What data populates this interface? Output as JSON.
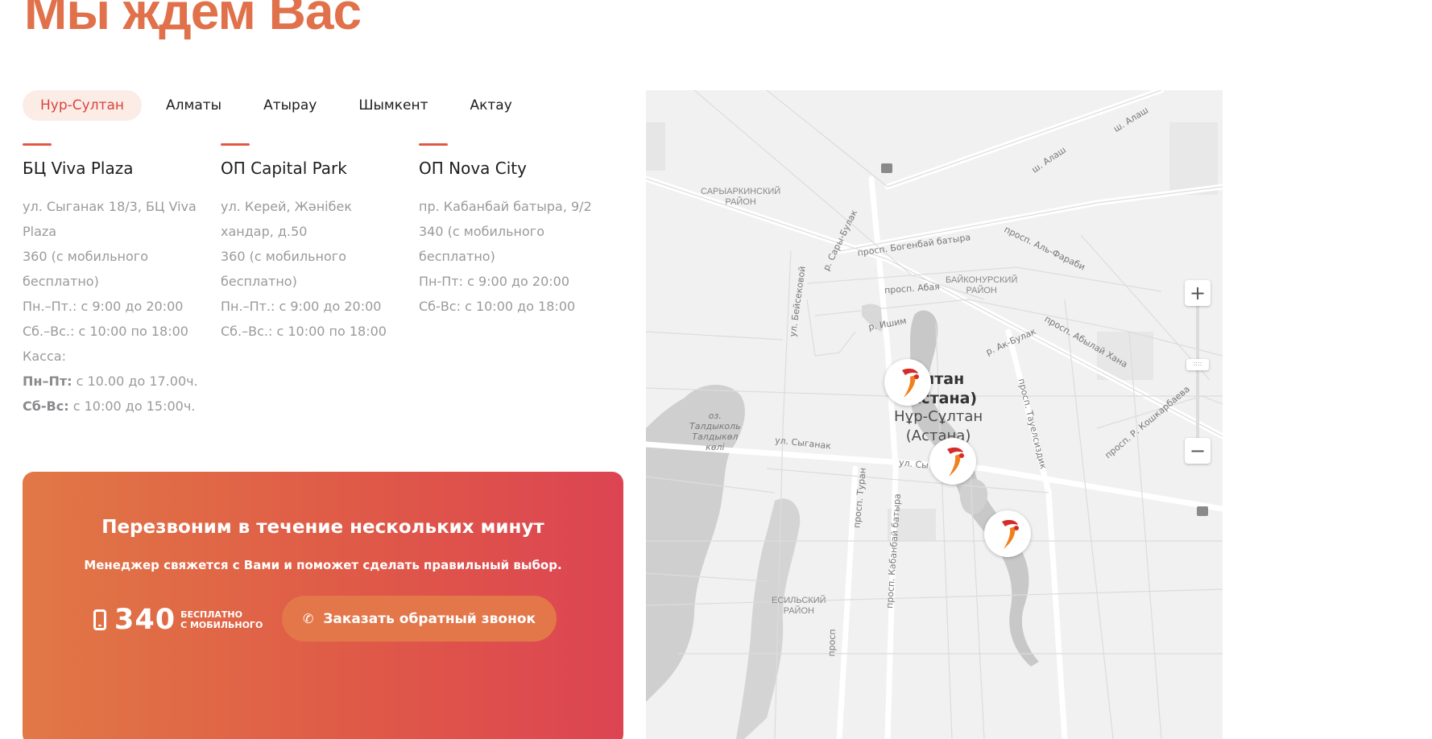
{
  "page": {
    "title": "Мы ждем Вас"
  },
  "cities": [
    "Нур-Султан",
    "Алматы",
    "Атырау",
    "Шымкент",
    "Актау"
  ],
  "active_city": "Нур-Султан",
  "offices": [
    {
      "name": "БЦ Viva Plaza",
      "lines": [
        "ул. Сыганак 18/3, БЦ Viva",
        "Plaza",
        "360 (с мобильного",
        "бесплатно)",
        "Пн.–Пт.: с 9:00 до 20:00",
        "Сб.–Вс.: с 10:00 по 18:00",
        "Касса:"
      ],
      "cash": [
        {
          "days": "Пн–Пт:",
          "hours": " с 10.00 до 17.00ч."
        },
        {
          "days": "Сб-Вс:",
          "hours": " с 10:00 до 15:00ч."
        }
      ]
    },
    {
      "name": "ОП Capital Park",
      "lines": [
        "ул. Керей, Жәнібек",
        "хандар, д.50",
        "360 (с мобильного",
        "бесплатно)",
        "Пн.–Пт.: с 9:00 до 20:00",
        "Сб.–Вс.: с 10:00 по 18:00"
      ],
      "cash": []
    },
    {
      "name": "ОП Nova City",
      "lines": [
        "пр. Кабанбай батыра, 9/2",
        "340 (с мобильного",
        "бесплатно)",
        "Пн-Пт: с 9:00 до 20:00",
        "Сб-Вс: с 10:00 до 18:00"
      ],
      "cash": []
    }
  ],
  "callback": {
    "title": "Перезвоним в течение нескольких минут",
    "subtitle": "Менеджер свяжется с Вами и поможет сделать правильный выбор.",
    "phone": "340",
    "phone_note_1": "БЕСПЛАТНО",
    "phone_note_2": "С МОБИЛЬНОГО",
    "button_label": "Заказать обратный звонок",
    "phone_icon": "mobile-phone-icon",
    "button_icon": "handset-icon"
  },
  "map": {
    "districts": {
      "saryarka": [
        "САРЫАРКИНСКИЙ",
        "РАЙОН"
      ],
      "baikonur": [
        "БАЙКОНУРСКИЙ",
        "РАЙОН"
      ],
      "esil": [
        "ЕСИЛЬСКИЙ",
        "РАЙОН"
      ]
    },
    "streets": {
      "alash1": "ш. Алаш",
      "alash2": "ш. Алаш",
      "farabi": "просп. Аль-Фараби",
      "bogenbai": "просп. Богенбай батыра",
      "abai": "просп. Абая",
      "sary_bulak": "р. Сары-Булак",
      "beibekova": "ул. Бейсековой",
      "ishim": "р. Ишим",
      "ak_bulak": "р. Ак-Булак",
      "abylai": "просп. Абылай Хана",
      "tauelsizdik": "просп. Тауелсиздик",
      "koshkarbaeva": "просп. Р. Кошкарбаева",
      "syganak": "ул. Сыганак",
      "sy_partial": "ул. Сы",
      "turan": "просп. Туран",
      "kabanbai": "просп. Кабанбай батыра",
      "bottom_partial": "просп"
    },
    "lake": [
      "оз.",
      "Талдыколь",
      "Талдыкөл",
      "көлі"
    ],
    "city_name_ru": [
      "Султан",
      "(Астана)"
    ],
    "city_name_kz": [
      "Нұр-Сұлтан",
      "(Астана)"
    ],
    "zoom_in": "+",
    "zoom_out": "−",
    "zoom_handle": "::::",
    "icons": [
      "station-icon",
      "station-icon-2",
      "location-marker-icon"
    ],
    "colors": {
      "water": "#cccccc",
      "roads": "#ffffff",
      "land": "#f1f1f1",
      "marker_red": "#d62b2b",
      "marker_orange": "#f0801e"
    }
  }
}
